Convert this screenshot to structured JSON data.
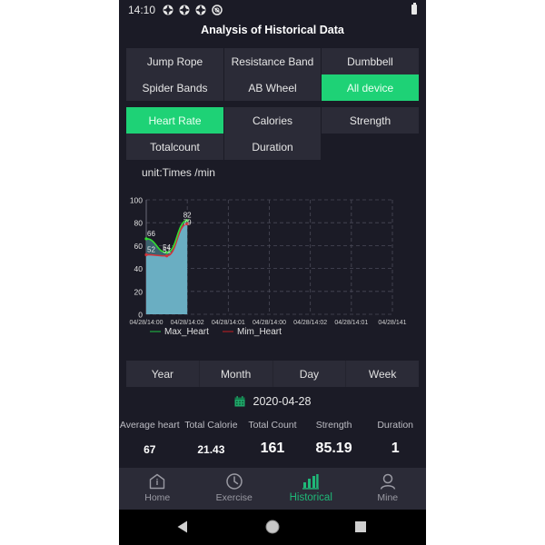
{
  "status_bar": {
    "time": "14:10",
    "icons": [
      "sync-icon",
      "sync-icon",
      "sync-icon",
      "accessibility-icon"
    ],
    "battery_icon": "battery-icon"
  },
  "header": {
    "title": "Analysis of Historical Data"
  },
  "device_filter": {
    "selected": "All device",
    "items": [
      "Jump Rope",
      "Resistance Band",
      "Dumbbell",
      "Spider Bands",
      "AB Wheel",
      "All device"
    ]
  },
  "metric_filter": {
    "selected": "Heart Rate",
    "items": [
      "Heart Rate",
      "Calories",
      "Strength",
      "Totalcount",
      "Duration"
    ]
  },
  "unit_label": "unit:Times /min",
  "colors": {
    "accent": "#1ed276",
    "max_line": "#33dd33",
    "min_line": "#d0343a",
    "area_fill": "#6aaec2",
    "tab_active": "#1fb878"
  },
  "chart_data": {
    "type": "area",
    "title": "",
    "xlabel": "",
    "ylabel": "Times /min",
    "ylim": [
      0,
      100
    ],
    "yticks": [
      0,
      20,
      40,
      60,
      80,
      100
    ],
    "x_tick_labels": [
      "04/28/14:00",
      "04/28/14:02",
      "04/28/14:01",
      "04/28/14:00",
      "04/28/14:02",
      "04/28/14:01",
      "04/28/141"
    ],
    "grid": true,
    "legend_position": "bottom-left",
    "x": [
      0,
      0.5,
      1
    ],
    "series": [
      {
        "name": "Max_Heart",
        "values": [
          66,
          54,
          82
        ],
        "color": "#33dd33"
      },
      {
        "name": "Mim_Heart",
        "values": [
          52,
          51,
          79
        ],
        "color": "#d0343a"
      }
    ]
  },
  "period_tabs": {
    "selected": "Day",
    "items": [
      "Year",
      "Month",
      "Day",
      "Week"
    ]
  },
  "date": {
    "icon": "calendar-icon",
    "value": "2020-04-28"
  },
  "stats": [
    {
      "label": "Average heart",
      "value": "67"
    },
    {
      "label": "Total Calorie",
      "value": "21.43"
    },
    {
      "label": "Total Count",
      "value": "161"
    },
    {
      "label": "Strength",
      "value": "85.19"
    },
    {
      "label": "Duration",
      "value": "1"
    }
  ],
  "tabbar": {
    "selected": "Historical",
    "items": [
      {
        "label": "Home",
        "icon": "home-icon"
      },
      {
        "label": "Exercise",
        "icon": "clock-icon"
      },
      {
        "label": "Historical",
        "icon": "bar-chart-icon"
      },
      {
        "label": "Mine",
        "icon": "user-icon"
      }
    ]
  },
  "navbar": {
    "back": "back-icon",
    "home": "home-circle-icon",
    "recents": "recents-icon"
  }
}
